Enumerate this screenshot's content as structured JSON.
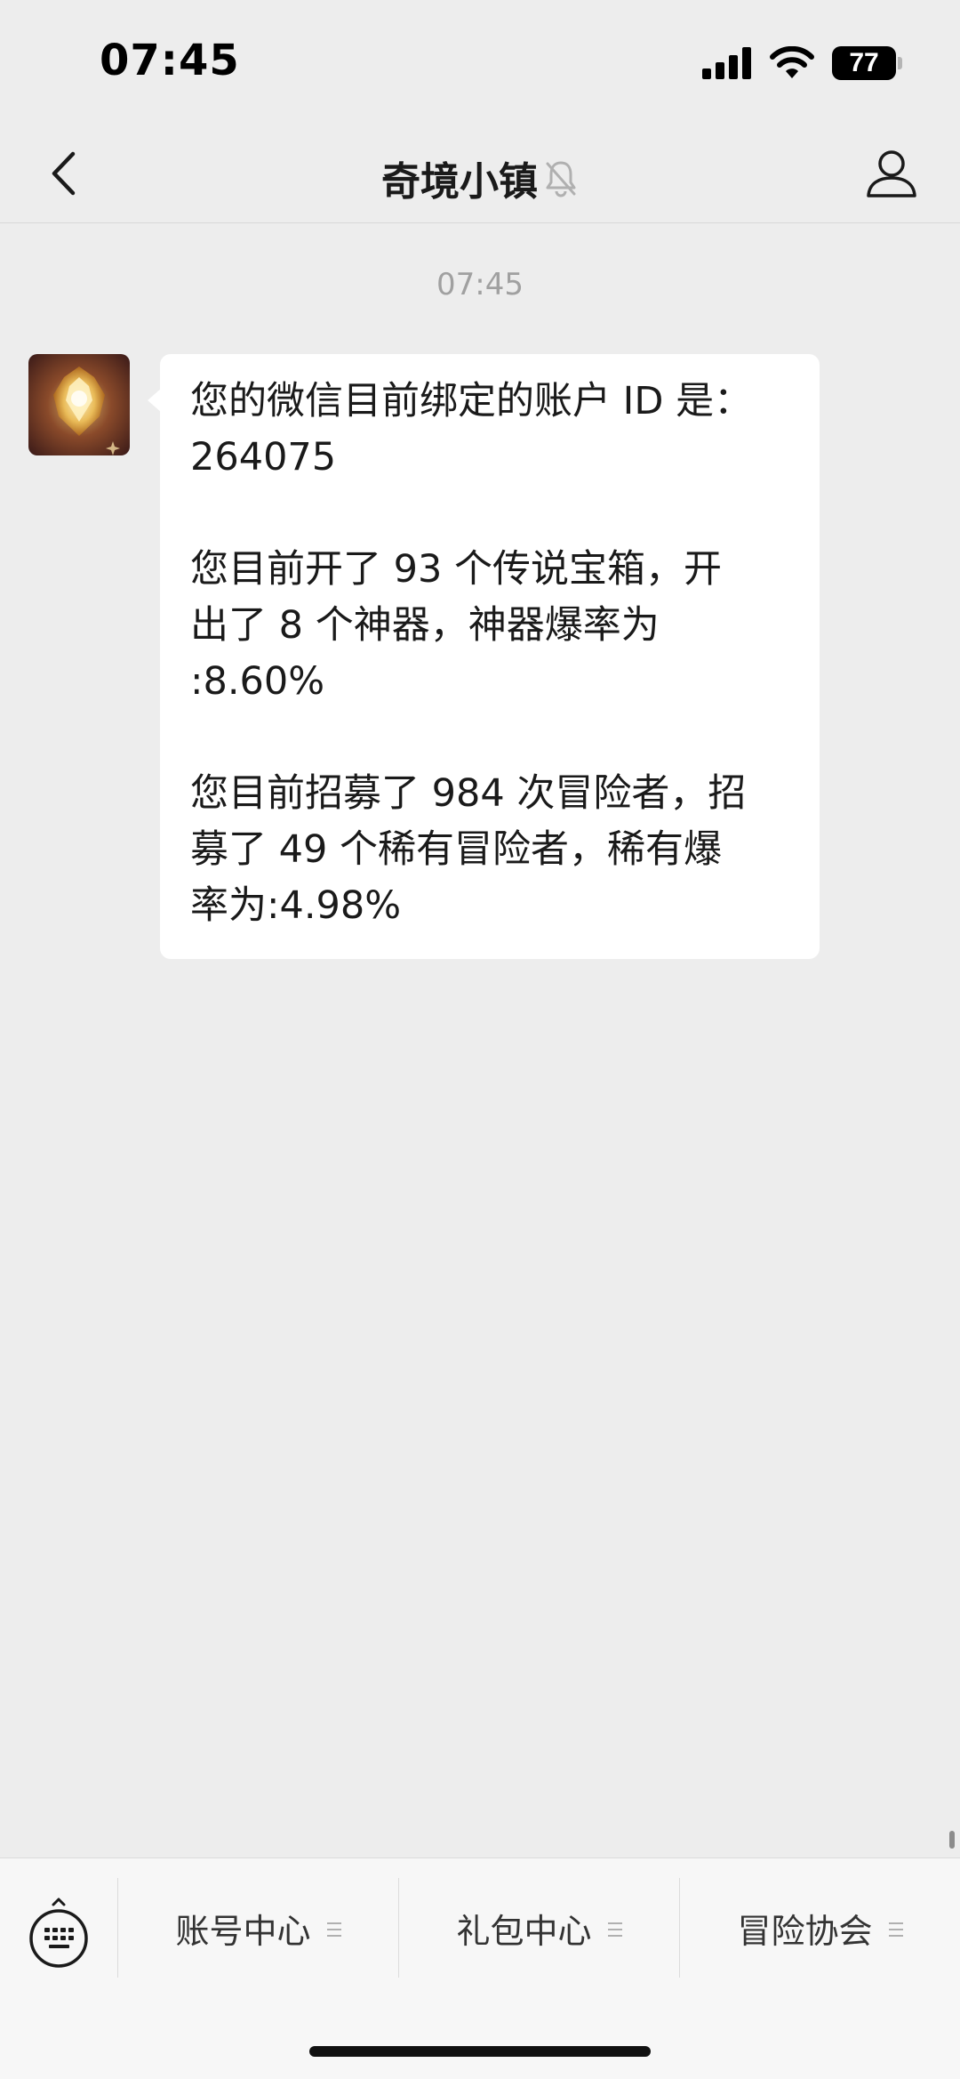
{
  "status_bar": {
    "time": "07:45",
    "battery": "77",
    "signal_icon": "cellular-signal-icon",
    "wifi_icon": "wifi-icon"
  },
  "nav": {
    "title": "奇境小镇",
    "muted_icon": "bell-slash-icon",
    "back_icon": "chevron-left-icon",
    "profile_icon": "person-icon"
  },
  "chat": {
    "timestamp": "07:45",
    "message": {
      "avatar_icon": "golden-emblem-avatar",
      "paragraphs": [
        "您的微信目前绑定的账户 ID 是：\n264075",
        "您目前开了 93 个传说宝箱，开\n出了 8 个神器，神器爆率为\n:8.60%",
        "您目前招募了 984 次冒险者，招\n募了 49 个稀有冒险者，稀有爆\n率为:4.98%"
      ]
    }
  },
  "bottom_menu": {
    "keyboard_icon": "keyboard-icon",
    "items": [
      {
        "label": "账号中心",
        "icon": "menu-lines-icon"
      },
      {
        "label": "礼包中心",
        "icon": "menu-lines-icon"
      },
      {
        "label": "冒险协会",
        "icon": "menu-lines-icon"
      }
    ]
  },
  "colors": {
    "background": "#ededed",
    "bubble": "#ffffff",
    "timestamp": "#a0a0a0",
    "bottom_bar": "#f7f7f7"
  }
}
